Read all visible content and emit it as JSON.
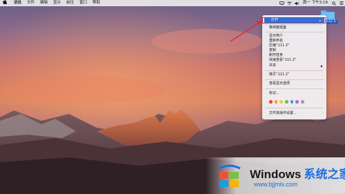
{
  "menubar": {
    "apple_icon": "apple-icon",
    "items": [
      "访达",
      "文件",
      "编辑",
      "显示",
      "前往",
      "窗口",
      "帮助"
    ],
    "status_icons": [
      "display-icon",
      "wifi-icon",
      "volume-icon"
    ],
    "clock": "周一 下午3:19",
    "search_icon": "search-icon",
    "list_icon": "menu-list-icon"
  },
  "desktop": {
    "folder_label": "111 2",
    "folder_color": "#5ab0ef"
  },
  "context_menu": {
    "open": "打开",
    "move_to_trash": "移到废纸篓",
    "get_info": "显示简介",
    "rename": "重新命名",
    "compress": "压缩“111 2”",
    "duplicate": "复制",
    "make_alias": "制作替身",
    "quick_look": "快速查看“111 2”",
    "share": "共享",
    "copy_item": "拷贝“111 2”",
    "view_options": "查看显示选项",
    "tags": "标记...",
    "tag_colors": [
      "#e8453c",
      "#f09a37",
      "#f2cd3c",
      "#61c554",
      "#3e9cf0",
      "#b36ad6",
      "#9d9d9d"
    ],
    "folder_actions": "文件夹操作设置..."
  },
  "highlight": {
    "color": "#e12b2b",
    "accent": "#2f6fe0"
  },
  "watermark": {
    "brand": "Windows",
    "brand_cn": "系统之家",
    "url": "www.bjjmlv.com"
  }
}
